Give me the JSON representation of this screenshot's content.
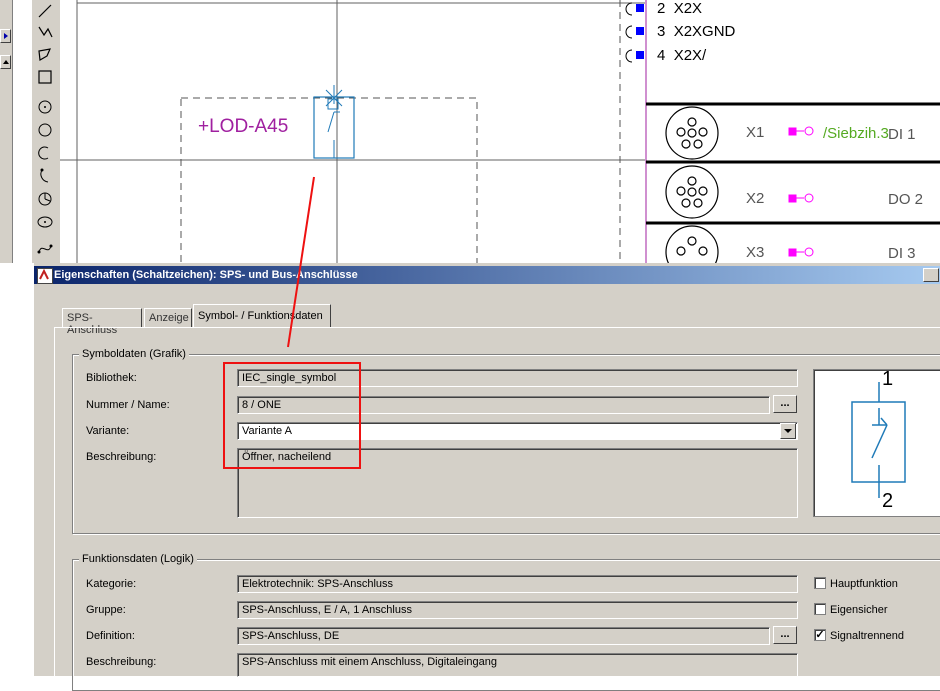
{
  "canvas": {
    "component_label": "+LOD-A45",
    "pins": [
      {
        "num": "2",
        "name": "X2X"
      },
      {
        "num": "3",
        "name": "X2XGND"
      },
      {
        "num": "4",
        "name": "X2X/"
      }
    ],
    "connectors": [
      {
        "name": "X1",
        "signal": "/Siebzih.3",
        "io": "DI 1"
      },
      {
        "name": "X2",
        "signal": "",
        "io": "DO 2"
      },
      {
        "name": "X3",
        "signal": "",
        "io": "DI 3"
      }
    ]
  },
  "dialog": {
    "title": "Eigenschaften (Schaltzeichen): SPS- und Bus-Anschlüsse",
    "tabs": [
      "SPS-Anschluss",
      "Anzeige",
      "Symbol- / Funktionsdaten"
    ],
    "active_tab": "Symbol- / Funktionsdaten",
    "symbol_group": {
      "title": "Symboldaten (Grafik)",
      "library_label": "Bibliothek:",
      "library_value": "IEC_single_symbol",
      "number_label": "Nummer / Name:",
      "number_value": "8 / ONE",
      "variant_label": "Variante:",
      "variant_value": "Variante A",
      "description_label": "Beschreibung:",
      "description_value": "Öffner, nacheilend",
      "browse_label": "...",
      "preview_pin_top": "1",
      "preview_pin_bottom": "2"
    },
    "function_group": {
      "title": "Funktionsdaten (Logik)",
      "category_label": "Kategorie:",
      "category_value": "Elektrotechnik: SPS-Anschluss",
      "group_label": "Gruppe:",
      "group_value": "SPS-Anschluss, E / A, 1 Anschluss",
      "definition_label": "Definition:",
      "definition_value": "SPS-Anschluss, DE",
      "description_label": "Beschreibung:",
      "description_value": "SPS-Anschluss mit einem Anschluss, Digitaleingang",
      "browse_label": "...",
      "checkboxes": [
        {
          "label": "Hauptfunktion",
          "checked": false
        },
        {
          "label": "Eigensicher",
          "checked": false
        },
        {
          "label": "Signaltrennend",
          "checked": true
        }
      ],
      "check_mark": "✓"
    }
  },
  "colors": {
    "annotation": "#ee1111",
    "label_magenta": "#a020a0",
    "symbol_blue": "#1f7ab8",
    "pin_blue": "#0000ff"
  }
}
